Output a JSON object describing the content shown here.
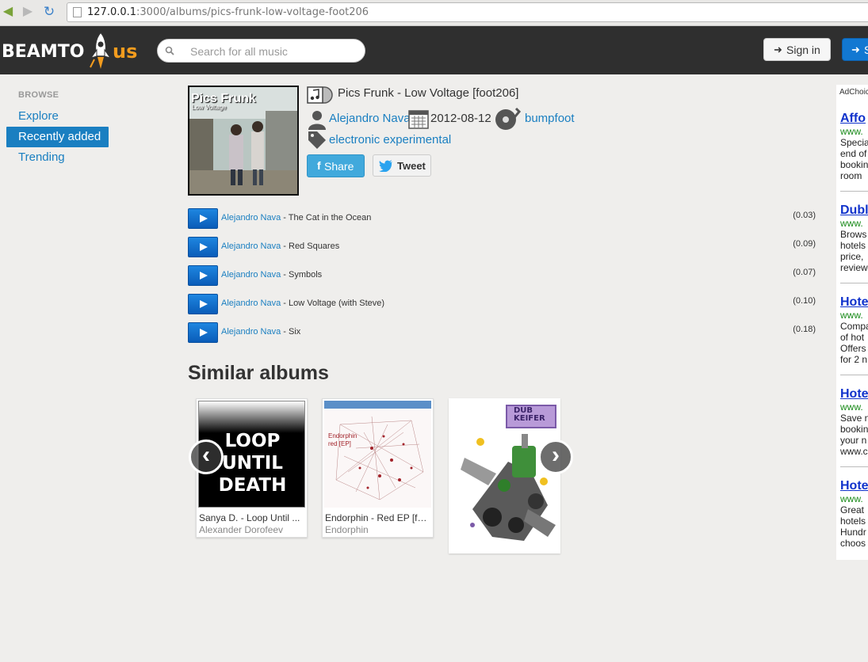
{
  "browser": {
    "url_host": "127.0.0.1",
    "url_path": ":3000/albums/pics-frunk-low-voltage-foot206"
  },
  "header": {
    "logo_left": "BEAMTO",
    "logo_right": "us",
    "search_placeholder": "Search for all music",
    "signin_label": "Sign in",
    "signup_label": "S"
  },
  "sidebar": {
    "heading": "BROWSE",
    "items": [
      {
        "label": "Explore",
        "active": false
      },
      {
        "label": "Recently added",
        "active": true
      },
      {
        "label": "Trending",
        "active": false
      }
    ]
  },
  "album": {
    "cover_title": "Pics Frunk",
    "cover_subtitle": "Low Voltage",
    "title": "Pics Frunk - Low Voltage [foot206]",
    "artist": "Alejandro Nava",
    "date": "2012-08-12",
    "label": "bumpfoot",
    "tags": "electronic experimental",
    "share_label": "Share",
    "tweet_label": "Tweet"
  },
  "tracks": [
    {
      "artist": "Alejandro Nava",
      "name": "The Cat in the Ocean",
      "duration": "(0.03)"
    },
    {
      "artist": "Alejandro Nava",
      "name": "Red Squares",
      "duration": "(0.09)"
    },
    {
      "artist": "Alejandro Nava",
      "name": "Symbols",
      "duration": "(0.07)"
    },
    {
      "artist": "Alejandro Nava",
      "name": "Low Voltage (with Steve)",
      "duration": "(0.10)"
    },
    {
      "artist": "Alejandro Nava",
      "name": "Six",
      "duration": "(0.18)"
    }
  ],
  "similar": {
    "heading": "Similar albums",
    "albums": [
      {
        "title": "Sanya D. - Loop Until ...",
        "artist": "Alexander Dorofeev",
        "cover_text": [
          "LOOP",
          "UNTIL",
          "DEATH"
        ]
      },
      {
        "title": "Endorphin - Red EP [fo...",
        "artist": "Endorphin",
        "cover_text": [
          "Endorphin",
          "red [EP]"
        ]
      },
      {
        "title": "",
        "artist": "",
        "cover_text": [
          "DUB",
          "KEIFER"
        ]
      }
    ]
  },
  "ads": {
    "choices": "AdChoices",
    "items": [
      {
        "title": "Affo",
        "url": "www.",
        "body": [
          "Specia",
          "end of",
          "bookin",
          "room"
        ]
      },
      {
        "title": "Dubl",
        "url": "www.",
        "body": [
          "Brows",
          "hotels",
          "price,",
          "review"
        ]
      },
      {
        "title": "Hote",
        "url": "www.",
        "body": [
          "Compa",
          "of hot",
          "Offers",
          "for 2 n"
        ]
      },
      {
        "title": "Hote",
        "url": "www.",
        "body": [
          "Save n",
          "bookin",
          "your n",
          "www.c"
        ]
      },
      {
        "title": "Hote",
        "url": "www.",
        "body": [
          "Great",
          "hotels",
          "Hundr",
          "choos"
        ]
      }
    ]
  },
  "colors": {
    "accent": "#1a7fc1",
    "topbar": "#2f2f2f",
    "logo_orange": "#f39c1e",
    "play_button": "#0a5cb8"
  }
}
